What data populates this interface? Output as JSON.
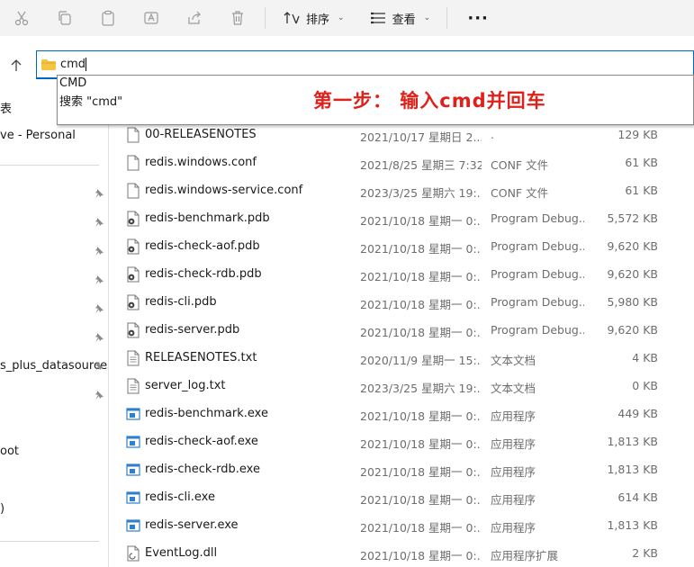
{
  "toolbar": {
    "icons": [
      "cut-icon",
      "copy-icon",
      "paste-icon",
      "rename-icon",
      "share-icon",
      "delete-icon"
    ],
    "sort_label": "排序",
    "view_label": "查看",
    "more_label": "···"
  },
  "address": {
    "value": "cmd"
  },
  "autocomplete": {
    "items": [
      "CMD",
      "搜索 \"cmd\""
    ]
  },
  "annotation": "第一步： 输入cmd并回车",
  "sidebar": {
    "items": [
      {
        "label": "表"
      },
      {
        "label": "ve - Personal"
      },
      {
        "label": "s_plus_datasources"
      },
      {
        "label": "oot"
      },
      {
        "label": ")"
      }
    ]
  },
  "files": [
    {
      "name": "00-RELEASENOTES",
      "date": "2021/10/17 星期日 2...",
      "type": ".",
      "size": "129 KB",
      "icon": "doc"
    },
    {
      "name": "redis.windows.conf",
      "date": "2021/8/25 星期三 7:32",
      "type": "CONF 文件",
      "size": "61 KB",
      "icon": "doc"
    },
    {
      "name": "redis.windows-service.conf",
      "date": "2023/3/25 星期六 19:...",
      "type": "CONF 文件",
      "size": "61 KB",
      "icon": "doc"
    },
    {
      "name": "redis-benchmark.pdb",
      "date": "2021/10/18 星期一 0:...",
      "type": "Program Debug...",
      "size": "5,572 KB",
      "icon": "pdb"
    },
    {
      "name": "redis-check-aof.pdb",
      "date": "2021/10/18 星期一 0:...",
      "type": "Program Debug...",
      "size": "9,620 KB",
      "icon": "pdb"
    },
    {
      "name": "redis-check-rdb.pdb",
      "date": "2021/10/18 星期一 0:...",
      "type": "Program Debug...",
      "size": "9,620 KB",
      "icon": "pdb"
    },
    {
      "name": "redis-cli.pdb",
      "date": "2021/10/18 星期一 0:...",
      "type": "Program Debug...",
      "size": "5,980 KB",
      "icon": "pdb"
    },
    {
      "name": "redis-server.pdb",
      "date": "2021/10/18 星期一 0:...",
      "type": "Program Debug...",
      "size": "9,620 KB",
      "icon": "pdb"
    },
    {
      "name": "RELEASENOTES.txt",
      "date": "2020/11/9 星期一 15:...",
      "type": "文本文档",
      "size": "4 KB",
      "icon": "txt"
    },
    {
      "name": "server_log.txt",
      "date": "2023/3/25 星期六 19:...",
      "type": "文本文档",
      "size": "0 KB",
      "icon": "txt"
    },
    {
      "name": "redis-benchmark.exe",
      "date": "2021/10/18 星期一 0:...",
      "type": "应用程序",
      "size": "449 KB",
      "icon": "exe"
    },
    {
      "name": "redis-check-aof.exe",
      "date": "2021/10/18 星期一 0:...",
      "type": "应用程序",
      "size": "1,813 KB",
      "icon": "exe"
    },
    {
      "name": "redis-check-rdb.exe",
      "date": "2021/10/18 星期一 0:...",
      "type": "应用程序",
      "size": "1,813 KB",
      "icon": "exe"
    },
    {
      "name": "redis-cli.exe",
      "date": "2021/10/18 星期一 0:...",
      "type": "应用程序",
      "size": "614 KB",
      "icon": "exe"
    },
    {
      "name": "redis-server.exe",
      "date": "2021/10/18 星期一 0:...",
      "type": "应用程序",
      "size": "1,813 KB",
      "icon": "exe"
    },
    {
      "name": "EventLog.dll",
      "date": "2021/10/18 星期一 0:...",
      "type": "应用程序扩展",
      "size": "2 KB",
      "icon": "dll"
    }
  ],
  "colors": {
    "accent": "#0067c0",
    "annotation": "#e0201a",
    "folder": "#f4c542"
  }
}
